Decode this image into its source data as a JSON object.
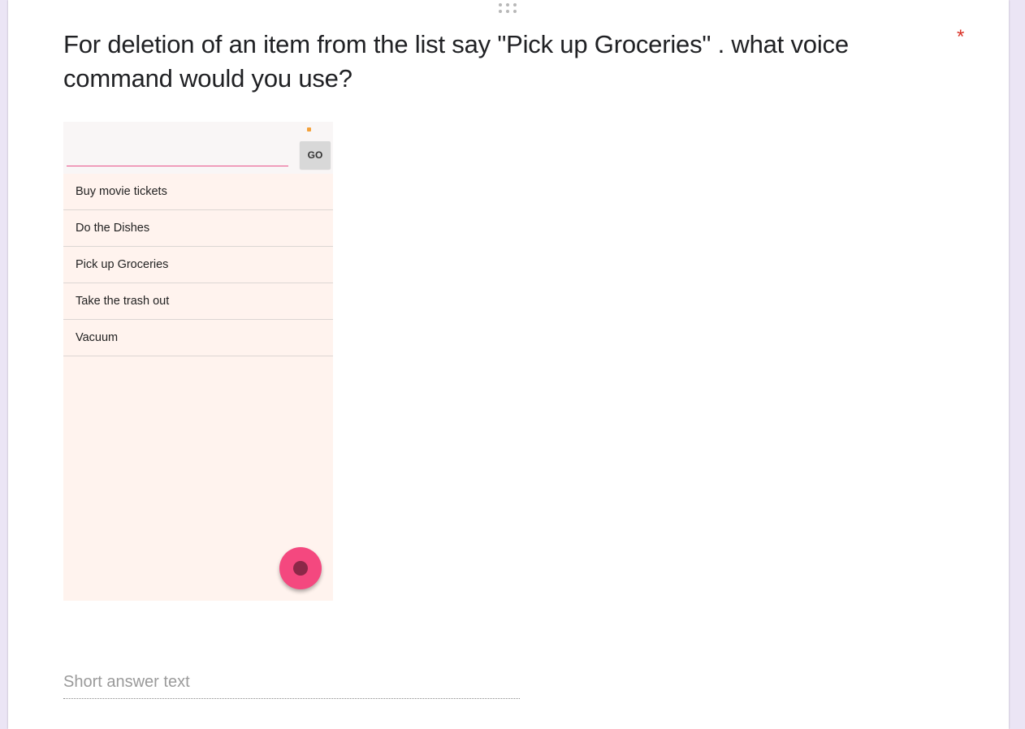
{
  "question": {
    "title": "For deletion of an item from the list say \"Pick up Groceries\" . what voice command would you use?",
    "required_marker": "*"
  },
  "embedded_app": {
    "go_button_label": "GO",
    "input_value": "",
    "items": [
      "Buy movie tickets",
      "Do the Dishes",
      "Pick up Groceries",
      "Take the trash out",
      "Vacuum"
    ],
    "fab_icon": "record-icon"
  },
  "answer": {
    "placeholder": "Short answer text"
  },
  "colors": {
    "page_background": "#ebe5f5",
    "required": "#d93025",
    "accent_pink": "#f4487f",
    "app_background": "#fff3ee"
  }
}
